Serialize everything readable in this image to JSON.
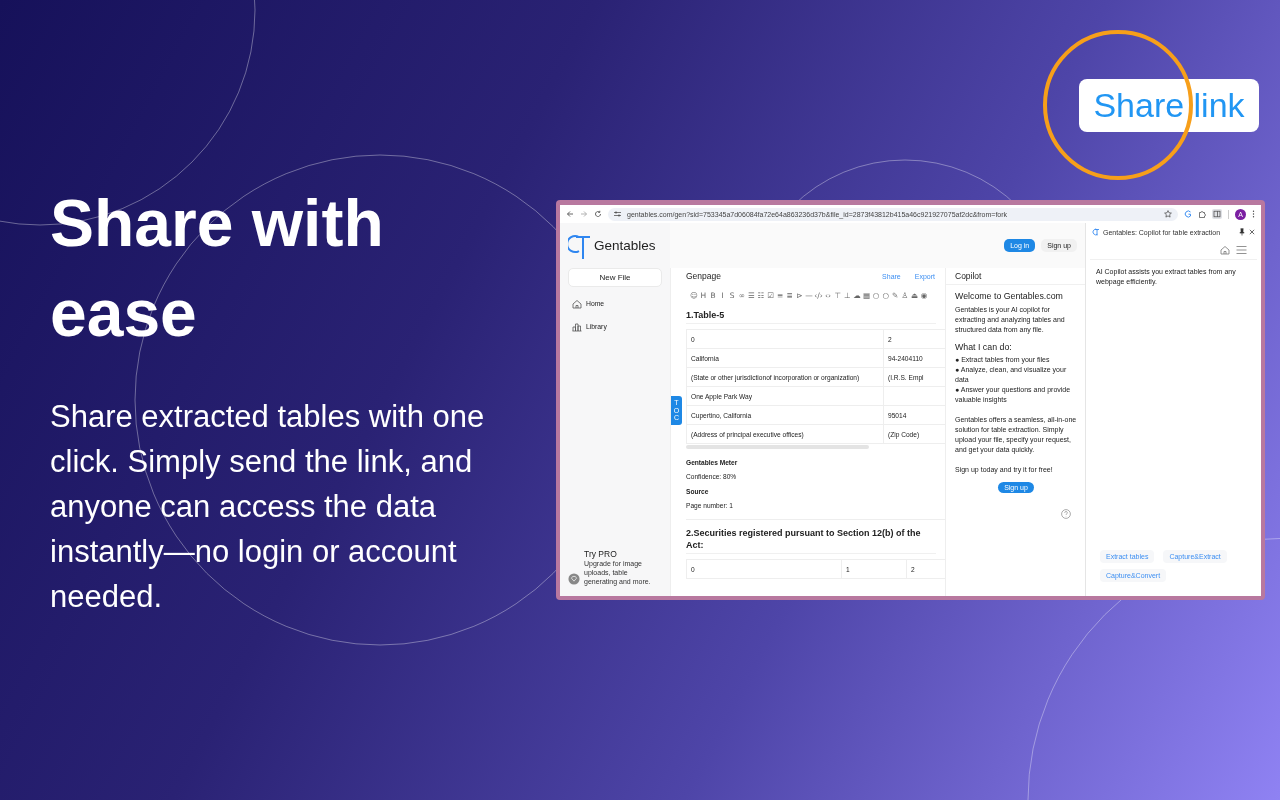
{
  "headline": "Share with ease",
  "description": "Share extracted tables with one click. Simply send the link, and anyone can access the data instantly—no login or account needed.",
  "callout": {
    "label": "Share link"
  },
  "browser": {
    "url": "gentables.com/gen?sid=753345a7d06084fa72e64a863236d37b&file_id=2873f43812b415a46c921927075af2dc&from=fork",
    "profile_initial": "A",
    "page": {
      "logo": "Gentables",
      "header_buttons": [
        {
          "label": "Log in",
          "kind": "primary"
        },
        {
          "label": "Sign up",
          "kind": "plain"
        }
      ],
      "sidebar": {
        "new_file": "New File",
        "items": [
          {
            "label": "Home",
            "kind": "home"
          },
          {
            "label": "Library",
            "kind": "library"
          }
        ],
        "promo": {
          "title": "Try PRO",
          "text": "Upgrade for image uploads, table generating and more."
        }
      },
      "editor": {
        "title": "Genpage",
        "actions": [
          "Share",
          "Export"
        ],
        "toolbar": [
          "☺",
          "H",
          "B",
          "I",
          "S",
          "∞",
          "☰",
          "☷",
          "☑",
          "≡",
          "≣",
          "⊳",
          "—",
          "‹/›",
          "‹›",
          "⊤",
          "⊥",
          "☁",
          "▦",
          "○",
          "○",
          "✎",
          "♙",
          "⏏",
          "◉"
        ],
        "toc": "TOC",
        "sections": [
          {
            "heading": "1.Table-5",
            "rows": [
              [
                "0",
                "2"
              ],
              [
                "California",
                "94-2404110"
              ],
              [
                "(State or other jurisdictionof incorporation or organization)",
                "(I.R.S. Empl"
              ],
              [
                "One Apple Park Way"
              ],
              [
                "Cupertino, California",
                "95014"
              ],
              [
                "(Address of principal executive offices)",
                "(Zip Code)"
              ]
            ],
            "meta": [
              {
                "kind": "label",
                "text": "Gentables Meter"
              },
              {
                "kind": "value",
                "text": "Confidence: 80%"
              },
              {
                "kind": "label",
                "text": "Source"
              },
              {
                "kind": "value",
                "text": "Page number: 1"
              }
            ]
          },
          {
            "heading": "2.Securities registered pursuant to Section 12(b) of the Act:",
            "rows": [
              [
                "0",
                "1",
                "2"
              ]
            ]
          }
        ]
      },
      "copilot": {
        "title": "Copilot",
        "welcome": "Welcome to Gentables.com",
        "intro": "Gentables is your AI copilot for extracting and analyzing tables and structured data from any file.",
        "subtitle": "What I can do:",
        "bullets": [
          "● Extract tables from your files",
          "● Analyze, clean, and visualize your data",
          "● Answer your questions and provide valuable insights"
        ],
        "summary": "Gentables offers a seamless, all-in-one solution for table extraction. Simply upload your file, specify your request, and get your data quickly.",
        "cta": "Sign up today and try it for free!",
        "button": "Sign up"
      }
    },
    "side_panel": {
      "title": "Gentables: Copilot for table extraction",
      "message": "AI Copilot assists you extract tables from any webpage efficiently.",
      "actions": [
        "Extract tables",
        "Capture&Extract",
        "Capture&Convert"
      ]
    }
  }
}
